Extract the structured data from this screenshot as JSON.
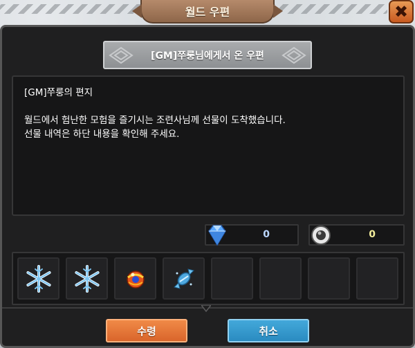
{
  "window": {
    "title": "월드 우편"
  },
  "mail": {
    "sender_title": "[GM]쭈룽님에게서 온 우편",
    "letter_title": "[GM]쭈룽의 편지",
    "body_line1": "월드에서 험난한 모험을 즐기시는 조련사님께 선물이 도착했습니다.",
    "body_line2": "선물 내역은 하단 내용을 확인해 주세요."
  },
  "currency": {
    "gems": "0",
    "coins": "0"
  },
  "attachments": [
    {
      "icon": "snowflake-icon"
    },
    {
      "icon": "snowflake-icon"
    },
    {
      "icon": "orb-icon"
    },
    {
      "icon": "candy-icon"
    },
    {
      "icon": ""
    },
    {
      "icon": ""
    },
    {
      "icon": ""
    },
    {
      "icon": ""
    }
  ],
  "buttons": {
    "receive_label": "수령",
    "cancel_label": "취소"
  },
  "colors": {
    "dialog_bg": "#1f1f20",
    "receive_button": "#e5773a",
    "cancel_button": "#3399cc",
    "title_tab": "#a07858",
    "close_button": "#d46a2c"
  }
}
